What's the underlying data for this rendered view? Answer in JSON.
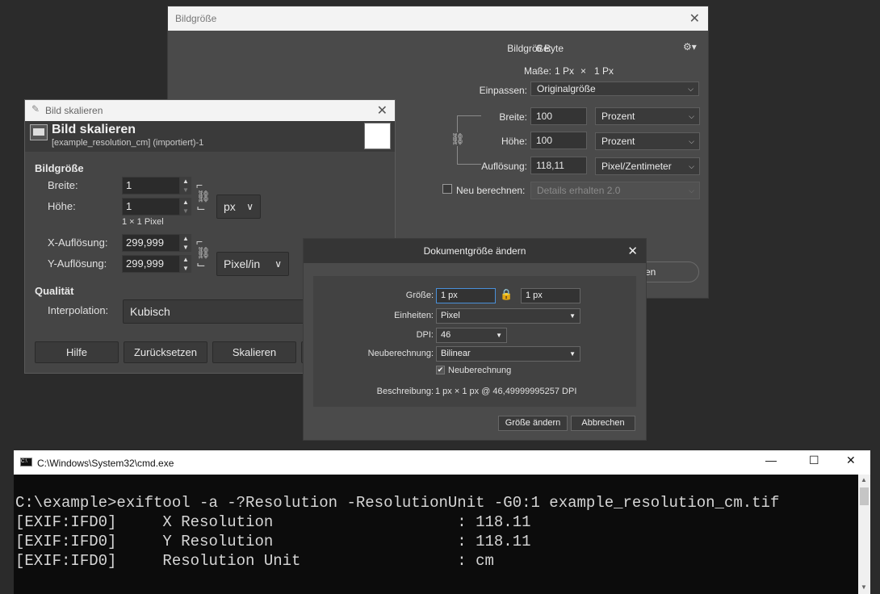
{
  "bildgroesse": {
    "title": "Bildgröße",
    "size_label": "Bildgröße:",
    "size_value": "6 Byte",
    "dims_label": "Maße:",
    "dims_w": "1 Px",
    "dims_x": "×",
    "dims_h": "1 Px",
    "fit_label": "Einpassen:",
    "fit_value": "Originalgröße",
    "width_label": "Breite:",
    "width_value": "100",
    "width_unit": "Prozent",
    "height_label": "Höhe:",
    "height_value": "100",
    "height_unit": "Prozent",
    "res_label": "Auflösung:",
    "res_value": "118,11",
    "res_unit": "Pixel/Zentimeter",
    "resample_label": "Neu berechnen:",
    "resample_value": "Details erhalten 2.0",
    "button_partial": "en"
  },
  "skalieren": {
    "window_title": "Bild skalieren",
    "header_title": "Bild skalieren",
    "header_subtitle": "[example_resolution_cm] (importiert)-1",
    "section_size": "Bildgröße",
    "width_label": "Breite:",
    "width_value": "1",
    "height_label": "Höhe:",
    "height_value": "1",
    "pixel_info": "1 × 1 Pixel",
    "size_unit": "px",
    "xres_label": "X-Auflösung:",
    "xres_value": "299,999",
    "yres_label": "Y-Auflösung:",
    "yres_value": "299,999",
    "res_unit": "Pixel/in",
    "section_quality": "Qualität",
    "interp_label": "Interpolation:",
    "interp_value": "Kubisch",
    "btn_help": "Hilfe",
    "btn_reset": "Zurücksetzen",
    "btn_scale": "Skalieren"
  },
  "dokument": {
    "title": "Dokumentgröße ändern",
    "size_label": "Größe:",
    "size_w": "1 px",
    "size_h": "1 px",
    "units_label": "Einheiten:",
    "units_value": "Pixel",
    "dpi_label": "DPI:",
    "dpi_value": "46",
    "resample_label": "Neuberechnung:",
    "resample_value": "Bilinear",
    "resample_check": "Neuberechnung",
    "desc_label": "Beschreibung:",
    "desc_value": "1 px × 1 px @ 46,49999995257 DPI",
    "btn_apply": "Größe ändern",
    "btn_cancel": "Abbrechen"
  },
  "cmd": {
    "title": "C:\\Windows\\System32\\cmd.exe",
    "icon_text": "C:\\",
    "lines": [
      "C:\\example>exiftool -a -?Resolution -ResolutionUnit -G0:1 example_resolution_cm.tif",
      "[EXIF:IFD0]     X Resolution                    : 118.11",
      "[EXIF:IFD0]     Y Resolution                    : 118.11",
      "[EXIF:IFD0]     Resolution Unit                 : cm"
    ]
  }
}
